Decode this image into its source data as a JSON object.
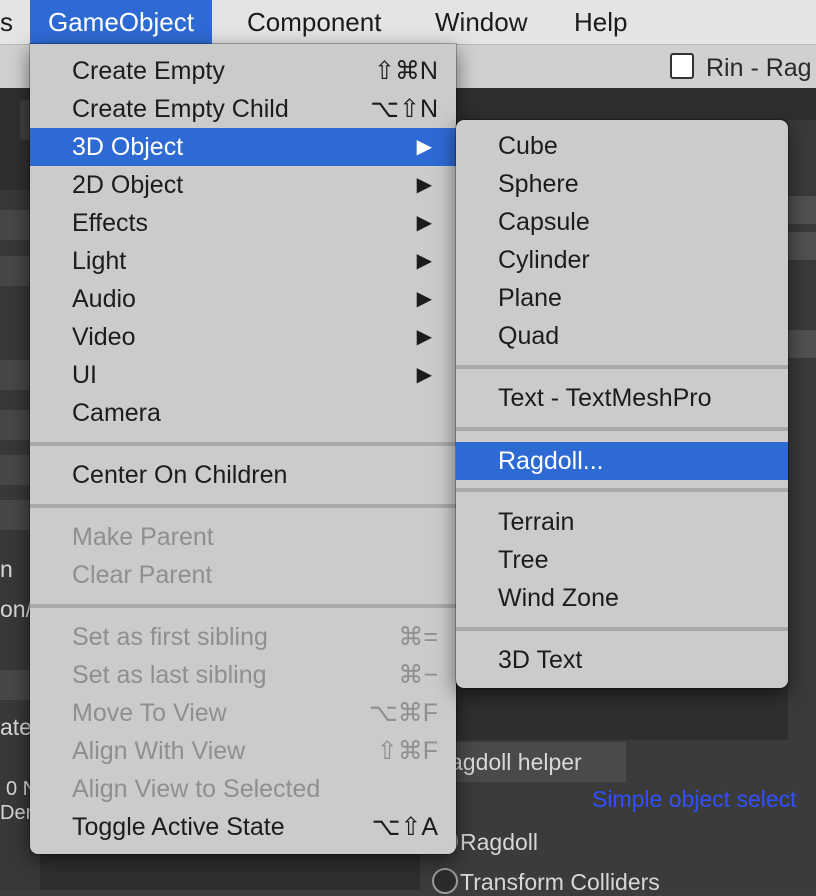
{
  "menubar": {
    "partial_left": "s",
    "items": [
      "GameObject",
      "Component",
      "Window",
      "Help"
    ]
  },
  "background": {
    "window_title": "Rin - Rag",
    "left_fragments": [
      "n",
      "on/",
      "ate",
      "0 N",
      "Den"
    ],
    "panel_tab": "agdoll helper",
    "link_text": "Simple object select",
    "radio_options": [
      "Ragdoll",
      "Transform Colliders"
    ]
  },
  "gameobject_menu": {
    "items": [
      {
        "label": "Create Empty",
        "shortcut": "⇧⌘N",
        "enabled": true
      },
      {
        "label": "Create Empty Child",
        "shortcut": "⌥⇧N",
        "enabled": true
      },
      {
        "label": "3D Object",
        "submenu": true,
        "enabled": true,
        "highlighted": true
      },
      {
        "label": "2D Object",
        "submenu": true,
        "enabled": true
      },
      {
        "label": "Effects",
        "submenu": true,
        "enabled": true
      },
      {
        "label": "Light",
        "submenu": true,
        "enabled": true
      },
      {
        "label": "Audio",
        "submenu": true,
        "enabled": true
      },
      {
        "label": "Video",
        "submenu": true,
        "enabled": true
      },
      {
        "label": "UI",
        "submenu": true,
        "enabled": true
      },
      {
        "label": "Camera",
        "enabled": true
      },
      {
        "label": "Center On Children",
        "enabled": true
      },
      {
        "label": "Make Parent",
        "enabled": false
      },
      {
        "label": "Clear Parent",
        "enabled": false
      },
      {
        "label": "Set as first sibling",
        "shortcut": "⌘=",
        "enabled": false
      },
      {
        "label": "Set as last sibling",
        "shortcut": "⌘−",
        "enabled": false
      },
      {
        "label": "Move To View",
        "shortcut": "⌥⌘F",
        "enabled": false
      },
      {
        "label": "Align With View",
        "shortcut": "⇧⌘F",
        "enabled": false
      },
      {
        "label": "Align View to Selected",
        "enabled": false
      },
      {
        "label": "Toggle Active State",
        "shortcut": "⌥⇧A",
        "enabled": true
      }
    ],
    "arrow_glyph": "▶"
  },
  "object3d_submenu": {
    "items": [
      {
        "label": "Cube"
      },
      {
        "label": "Sphere"
      },
      {
        "label": "Capsule"
      },
      {
        "label": "Cylinder"
      },
      {
        "label": "Plane"
      },
      {
        "label": "Quad"
      },
      {
        "label": "Text - TextMeshPro"
      },
      {
        "label": "Ragdoll...",
        "highlighted": true
      },
      {
        "label": "Terrain"
      },
      {
        "label": "Tree"
      },
      {
        "label": "Wind Zone"
      },
      {
        "label": "3D Text"
      }
    ]
  },
  "colors": {
    "highlight": "#2e6ad4",
    "menu_bg": "#cbcbcb",
    "disabled_text": "#8f8f8f",
    "link": "#3050ff"
  }
}
